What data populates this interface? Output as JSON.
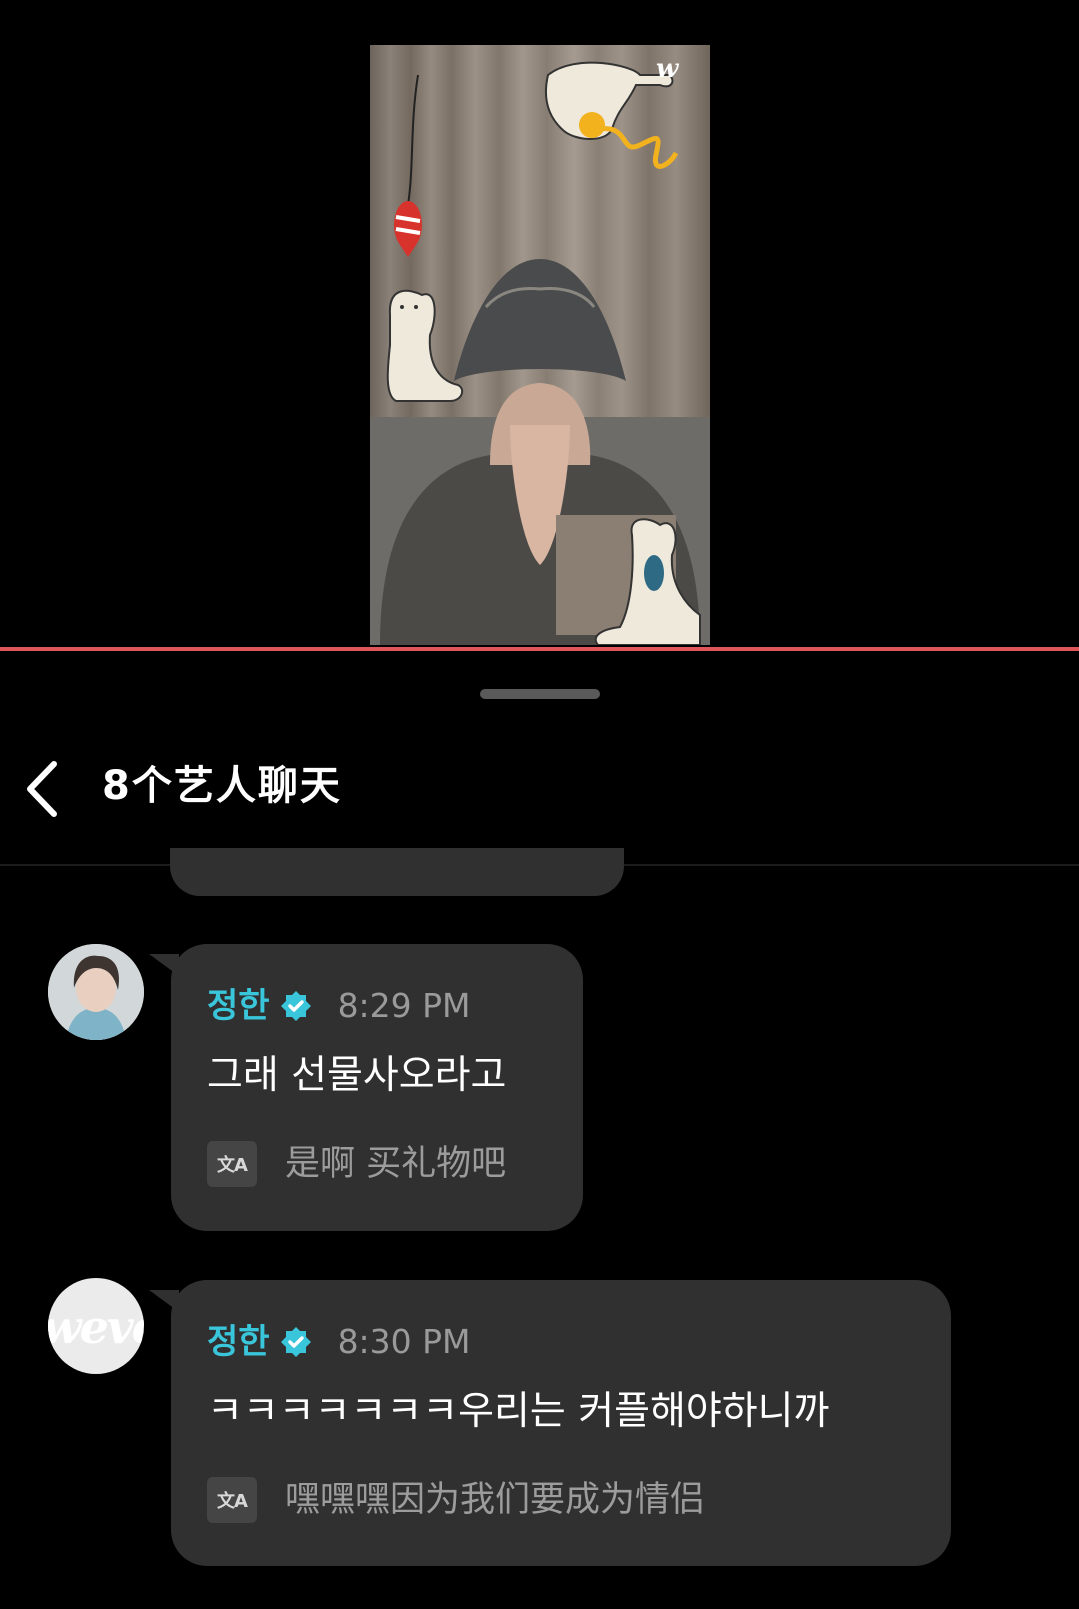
{
  "header": {
    "title": "8个艺人聊天",
    "back_icon": "chevron-left-icon"
  },
  "stream": {
    "watermark": "w"
  },
  "messages": [
    {
      "sender": "정한",
      "verified": true,
      "time": "8:29 PM",
      "text": "그래 선물사오라고",
      "translation": "是啊 买礼物吧",
      "translate_icon_label": "文A"
    },
    {
      "sender": "정한",
      "verified": true,
      "time": "8:30 PM",
      "text": "ㅋㅋㅋㅋㅋㅋㅋ우리는 커플해야하니까",
      "translation": "嘿嘿嘿因为我们要成为情侣",
      "translate_icon_label": "文A",
      "avatar_logo": "weve"
    }
  ],
  "colors": {
    "accent_name": "#3ac6da",
    "bubble": "#303030",
    "progress": "#e0575b",
    "background": "#000000"
  }
}
